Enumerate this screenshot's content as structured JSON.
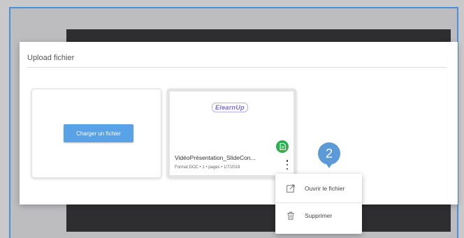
{
  "modal": {
    "title": "Upload fichier"
  },
  "upload_card": {
    "button_label": "Charger un fichier"
  },
  "file_card": {
    "thumbnail_logo_text": "ElearnUp",
    "file_name": "VidéoPrésentation_SlideCon...",
    "file_meta": "Format DOC • 1 • pages • 1/7/2019",
    "badge_icon": "document-icon",
    "badge_color": "#2fae4d"
  },
  "context_menu": {
    "items": [
      {
        "label": "Ouvrir le fichier",
        "icon": "open-external-icon"
      },
      {
        "label": "Supprimer",
        "icon": "trash-icon"
      }
    ]
  },
  "step_marker": {
    "number": "2",
    "color": "#5b9ad6"
  },
  "colors": {
    "accent": "#5aa2e6",
    "frame_border": "#4a90d9"
  }
}
